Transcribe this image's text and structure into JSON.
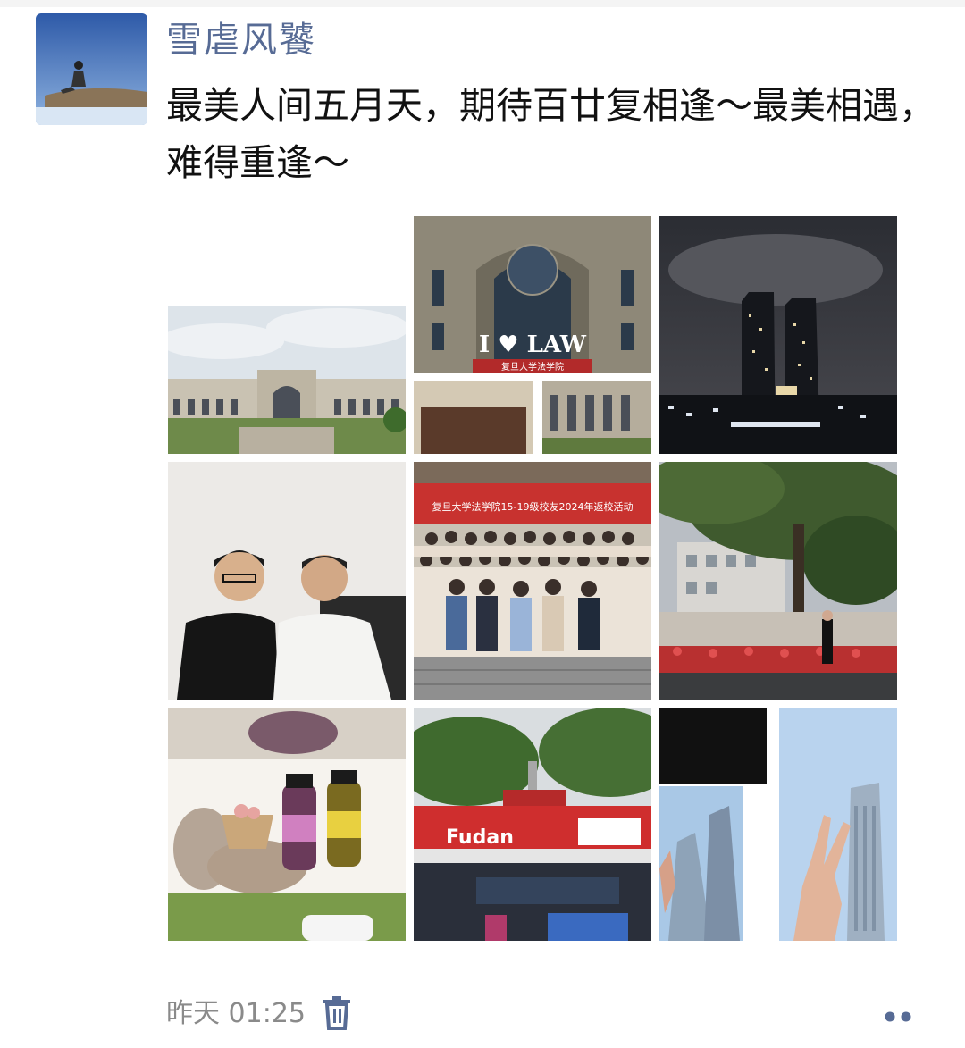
{
  "post": {
    "username": "雪虐风饕",
    "text": "最美人间五月天，期待百廿复相逢～最美相遇，难得重逢～",
    "time": "昨天 01:25"
  },
  "photos": {
    "p2_sign": "I ♥ LAW",
    "p2_caption": "复旦大学法学院",
    "p5_banner": "复旦大学法学院15-19级校友2024年返校活动",
    "p8_sign": "Fudan"
  },
  "icons": {
    "delete": "trash-icon",
    "more": "more-dots-icon"
  },
  "colors": {
    "username": "#576b95",
    "time": "#8a8a8a",
    "text": "#111111"
  }
}
